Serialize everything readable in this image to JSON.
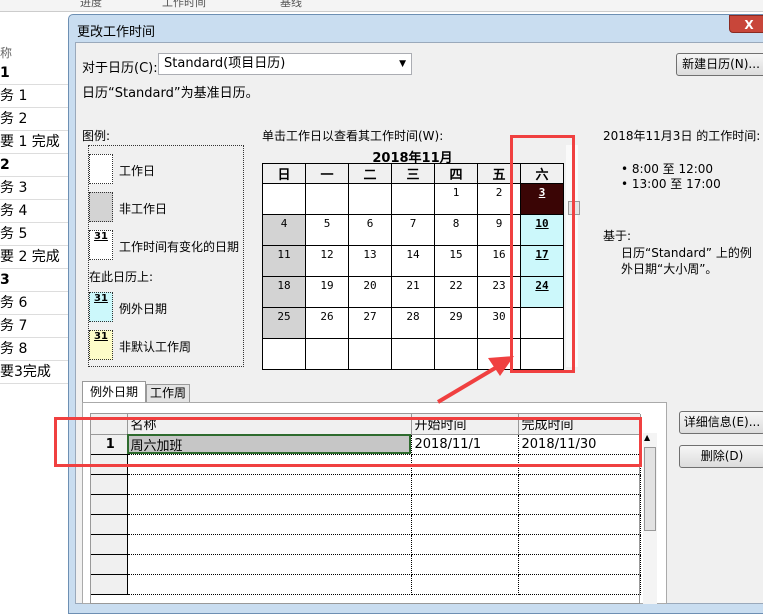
{
  "background": {
    "headers": [
      "进度",
      "工作时间",
      "基线"
    ],
    "column_label": "称",
    "rows": [
      {
        "text": "1",
        "bold": true
      },
      {
        "text": "务 1"
      },
      {
        "text": "务 2"
      },
      {
        "text": "要 1 完成"
      },
      {
        "text": "2",
        "bold": true
      },
      {
        "text": "务 3"
      },
      {
        "text": "务 4"
      },
      {
        "text": "务 5"
      },
      {
        "text": "要 2 完成"
      },
      {
        "text": "3",
        "bold": true
      },
      {
        "text": "务 6"
      },
      {
        "text": "务 7"
      },
      {
        "text": "务 8"
      },
      {
        "text": "要3完成"
      }
    ]
  },
  "dialog": {
    "title": "更改工作时间",
    "close": "X",
    "calendar_label": "对于日历(C):",
    "calendar_value": "Standard(项目日历)",
    "new_calendar": "新建日历(N)...",
    "base_note": "日历“Standard”为基准日历。",
    "legend": {
      "title": "图例:",
      "working": "工作日",
      "nonworking": "非工作日",
      "changed": "工作时间有变化的日期",
      "on_this": "在此日历上:",
      "exception": "例外日期",
      "nondefault": "非默认工作周",
      "sample": "31"
    },
    "click_hint": "单击工作日以查看其工作时间(W):",
    "month": "2018年11月",
    "weekdays": [
      "日",
      "一",
      "二",
      "三",
      "四",
      "五",
      "六"
    ],
    "weeks": [
      [
        "",
        "",
        "",
        "",
        "1",
        "2",
        "3"
      ],
      [
        "4",
        "5",
        "6",
        "7",
        "8",
        "9",
        "10"
      ],
      [
        "11",
        "12",
        "13",
        "14",
        "15",
        "16",
        "17"
      ],
      [
        "18",
        "19",
        "20",
        "21",
        "22",
        "23",
        "24"
      ],
      [
        "25",
        "26",
        "27",
        "28",
        "29",
        "30",
        ""
      ],
      [
        "",
        "",
        "",
        "",
        "",
        "",
        ""
      ]
    ],
    "info": {
      "title": "2018年11月3日 的工作时间:",
      "times": [
        "8:00 至 12:00",
        "13:00 至 17:00"
      ],
      "based_label": "基于:",
      "based_text": "日历“Standard” 上的例外日期“大小周”。"
    },
    "tabs": [
      "例外日期",
      "工作周"
    ],
    "table": {
      "headers": [
        "名称",
        "开始时间",
        "完成时间"
      ],
      "rows": [
        [
          "1",
          "周六加班",
          "2018/11/1",
          "2018/11/30"
        ]
      ]
    },
    "details": "详细信息(E)...",
    "delete": "删除(D)"
  },
  "colors": {
    "highlight": "#f04040",
    "selected_day": "#3a0505",
    "exception_day": "#ccf8fb"
  }
}
